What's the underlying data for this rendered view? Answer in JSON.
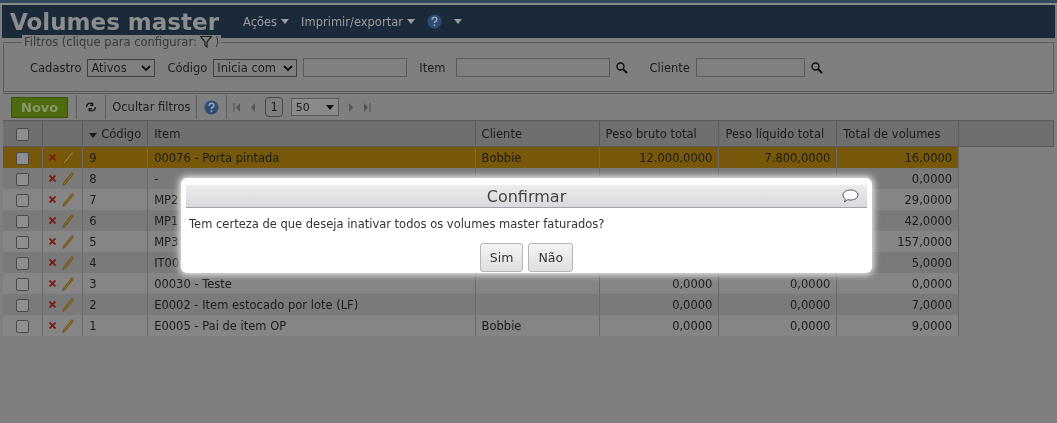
{
  "header": {
    "title": "Volumes master",
    "menus": [
      {
        "label": "Ações"
      },
      {
        "label": "Imprimir/exportar"
      }
    ]
  },
  "filters": {
    "legend": "Filtros (clique para configurar:",
    "legend_end": ")",
    "fields": [
      {
        "kind": "select",
        "label": "Cadastro",
        "value": "Ativos"
      },
      {
        "kind": "select-input",
        "label": "Código",
        "value": "Inicia com"
      },
      {
        "kind": "search",
        "label": "Item"
      },
      {
        "kind": "search",
        "label": "Cliente"
      }
    ]
  },
  "toolbar": {
    "new_button": "Novo",
    "toggle_filters": "Ocultar filtros",
    "page": "1",
    "page_size": "50"
  },
  "table": {
    "columns": [
      {
        "kind": "check",
        "checked": false
      },
      {
        "kind": "actions"
      },
      {
        "label": "Código",
        "sorted": true
      },
      {
        "label": "Item",
        "sorted": false
      },
      {
        "label": "Cliente",
        "sorted": false
      },
      {
        "label": "Peso bruto total",
        "sorted": false
      },
      {
        "label": "Peso líquido total",
        "sorted": false
      },
      {
        "label": "Total de volumes",
        "sorted": false
      }
    ],
    "rows": [
      {
        "selected": true,
        "checked": false,
        "code": "9",
        "item": "00076 - Porta pintada",
        "client": "Bobbie",
        "gross": "12.000,0000",
        "net": "7.800,0000",
        "total": "16,0000"
      },
      {
        "selected": false,
        "checked": false,
        "code": "8",
        "item": "-",
        "total": "0,0000"
      },
      {
        "selected": false,
        "checked": false,
        "code": "7",
        "item": "MP2",
        "total": "29,0000"
      },
      {
        "selected": false,
        "checked": false,
        "code": "6",
        "item": "MP1",
        "total": "42,0000"
      },
      {
        "selected": false,
        "checked": false,
        "code": "5",
        "item": "MP3",
        "total": "157,0000"
      },
      {
        "selected": false,
        "checked": false,
        "code": "4",
        "item": "IT00",
        "total": "5,0000"
      },
      {
        "selected": false,
        "checked": false,
        "code": "3",
        "item": "00030 - Teste",
        "gross": "0,0000",
        "net": "0,0000",
        "total": "0,0000"
      },
      {
        "selected": false,
        "checked": false,
        "code": "2",
        "item": "E0002 - Item estocado por lote (LF)",
        "gross": "0,0000",
        "net": "0,0000",
        "total": "7,0000"
      },
      {
        "selected": false,
        "checked": false,
        "code": "1",
        "item": "E0005 - Pai de item OP",
        "client": "Bobbie",
        "gross": "0,0000",
        "net": "0,0000",
        "total": "9,0000"
      }
    ]
  },
  "dialog": {
    "title": "Confirmar",
    "message": "Tem certeza de que deseja inativar todos os volumes master faturados?",
    "buttons": [
      "Sim",
      "Não"
    ]
  }
}
